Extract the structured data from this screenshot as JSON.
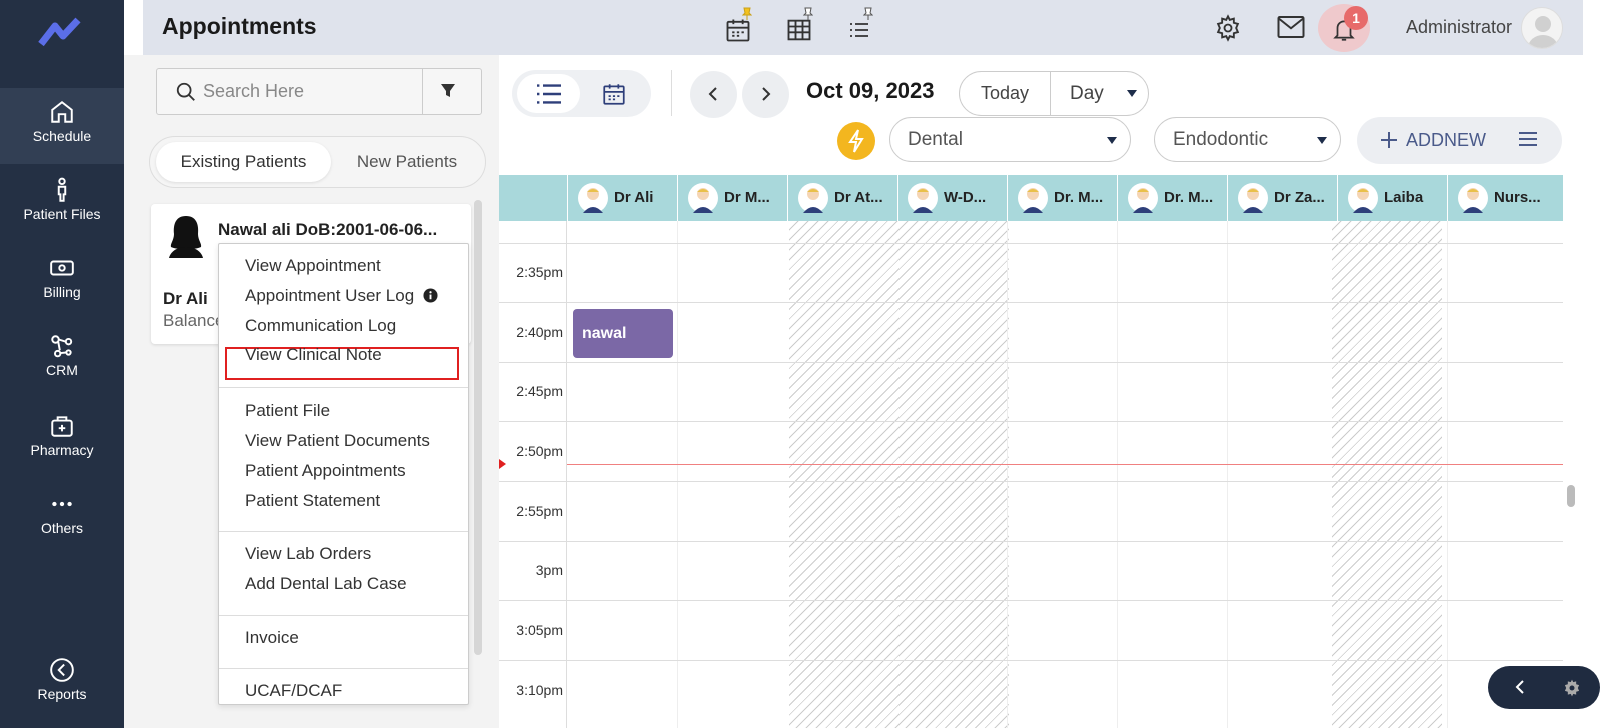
{
  "app": {
    "title": "Appointments",
    "admin": "Administrator",
    "notif_count": "1"
  },
  "sidebar": {
    "items": [
      {
        "label": "Schedule",
        "icon": "home-icon"
      },
      {
        "label": "Patient Files",
        "icon": "person-icon"
      },
      {
        "label": "Billing",
        "icon": "money-icon"
      },
      {
        "label": "CRM",
        "icon": "network-icon"
      },
      {
        "label": "Pharmacy",
        "icon": "medical-bag-icon"
      },
      {
        "label": "Others",
        "icon": "more-dots-icon"
      },
      {
        "label": "Reports",
        "icon": "reports-icon"
      }
    ]
  },
  "search": {
    "placeholder": "Search Here"
  },
  "tabs": {
    "existing": "Existing Patients",
    "new": "New Patients"
  },
  "patient": {
    "name": "Nawal ali DoB:2001-06-06...",
    "doctor": "Dr Ali",
    "balance": "Balance"
  },
  "menu": {
    "items": [
      "View Appointment",
      "Appointment User Log",
      "Communication Log",
      "View Clinical Note",
      "Patient File",
      "View Patient Documents",
      "Patient Appointments",
      "Patient Statement",
      "View Lab Orders",
      "Add Dental Lab Case",
      "Invoice",
      "UCAF/DCAF"
    ]
  },
  "toolbar": {
    "date": "Oct 09, 2023",
    "today": "Today",
    "view": "Day",
    "specialty": "Dental",
    "subspecialty": "Endodontic",
    "addnew": "ADDNEW"
  },
  "doctors": [
    "Dr Ali",
    "Dr M...",
    "Dr At...",
    "W-D...",
    "Dr. M...",
    "Dr. M...",
    "Dr Za...",
    "Laiba",
    "Nurs..."
  ],
  "times": [
    "2:35pm",
    "2:40pm",
    "2:45pm",
    "2:50pm",
    "2:55pm",
    "3pm",
    "3:05pm",
    "3:10pm"
  ],
  "appointment": {
    "label": "nawal"
  },
  "colors": {
    "sidebar": "#243044",
    "appointment": "#7b68a6",
    "header": "#a9d8db",
    "accent": "#f3b61f"
  }
}
